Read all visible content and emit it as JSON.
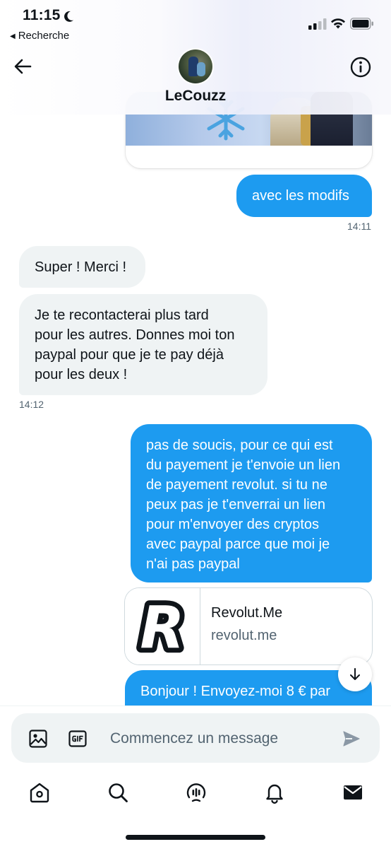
{
  "status_bar": {
    "time": "11:15",
    "back_app_label": "Recherche"
  },
  "header": {
    "contact_name": "LeCouzz"
  },
  "messages": [
    {
      "side": "out",
      "text": "avec les modifs",
      "time": "14:11"
    },
    {
      "side": "in",
      "text": "Super ! Merci !"
    },
    {
      "side": "in",
      "text": "Je te recontacterai plus tard\npour les autres. Donnes moi ton\npaypal pour que je te pay déjà\npour les deux !",
      "time": "14:12"
    },
    {
      "side": "out",
      "text": "pas de soucis, pour ce qui est\ndu payement je t'envoie un lien\nde payement revolut. si tu ne\npeux pas je t'enverrai un lien\npour m'envoyer des cryptos\navec paypal parce que moi je\nn'ai pas paypal"
    }
  ],
  "link_card": {
    "title": "Revolut.Me",
    "domain": "revolut.me",
    "logo_letter": "R"
  },
  "partial_message": {
    "line1": "Bonjour ! Envoyez-moi 8 € par",
    "line2": "                                        "
  },
  "composer": {
    "placeholder": "Commencez un message"
  },
  "colors": {
    "accent": "#1d9bf0",
    "incoming_bubble": "#eff3f4",
    "text": "#0f1419",
    "secondary_text": "#536471"
  },
  "icons": {
    "status": [
      "moon-icon",
      "signal-icon",
      "wifi-icon",
      "battery-icon"
    ],
    "header": [
      "back-arrow-icon",
      "info-icon"
    ],
    "composer": [
      "image-icon",
      "gif-icon",
      "send-icon"
    ],
    "tabbar": [
      "home-icon",
      "search-icon",
      "spaces-icon",
      "notifications-icon",
      "messages-icon"
    ]
  }
}
